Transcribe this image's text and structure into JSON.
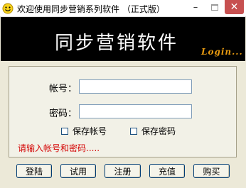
{
  "window": {
    "title": "欢迎使用同步营销系列软件 （正式版）",
    "minimize_glyph": "–",
    "close_glyph": "✕"
  },
  "banner": {
    "title": "同步营销软件",
    "login_text": "Login..."
  },
  "form": {
    "account_label": "帐号：",
    "account_value": "",
    "password_label": "密码：",
    "password_value": "",
    "save_account_label": "保存帐号",
    "save_account_checked": false,
    "save_password_label": "保存密码",
    "save_password_checked": false,
    "hint": "请输入帐号和密码....."
  },
  "buttons": {
    "login": "登陆",
    "trial": "试用",
    "register": "注册",
    "recharge": "充值",
    "buy": "购买"
  },
  "colors": {
    "hint_red": "#d40000",
    "login_orange": "#e89a10",
    "close_red": "#c75050"
  }
}
